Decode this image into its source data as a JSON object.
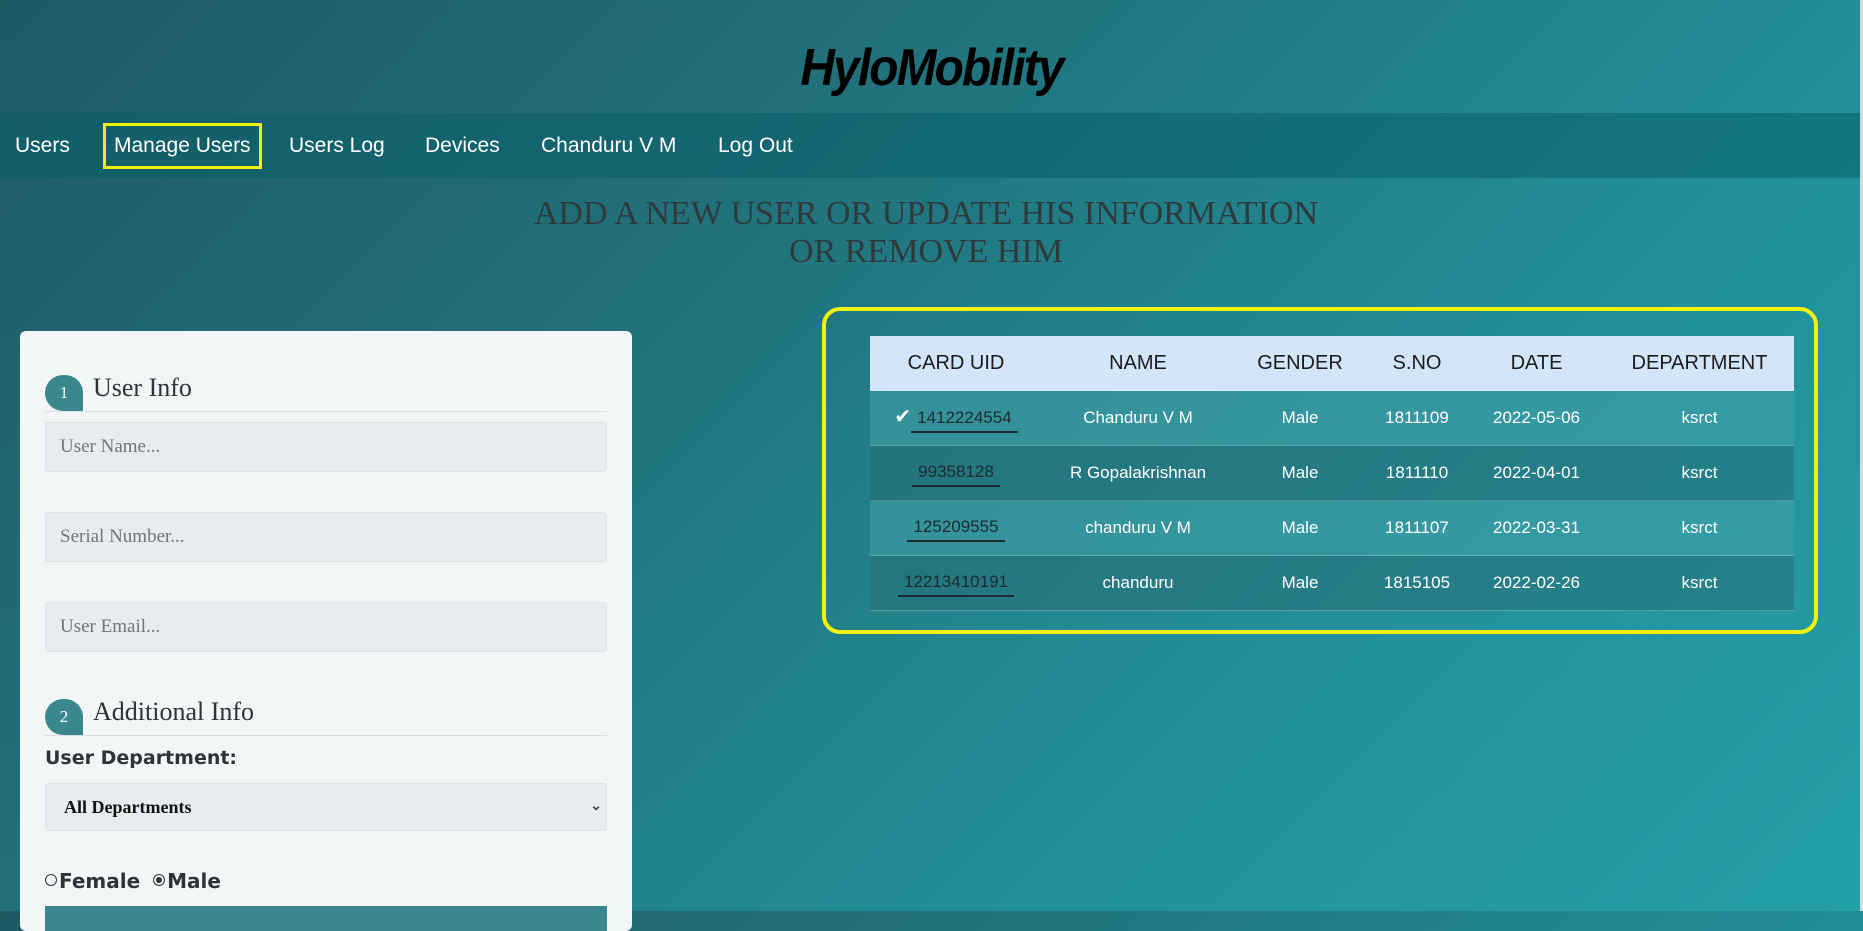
{
  "brand": "HyloMobility",
  "nav": {
    "items": [
      "Users",
      "Manage Users",
      "Users Log",
      "Devices",
      "Chanduru V M",
      "Log Out"
    ],
    "active": "Manage Users"
  },
  "heading": {
    "line1": "ADD A NEW USER OR UPDATE HIS INFORMATION",
    "line2": "OR REMOVE HIM"
  },
  "form": {
    "section1": {
      "number": "1",
      "title": "User Info"
    },
    "fields": {
      "username_placeholder": "User Name...",
      "serial_placeholder": "Serial Number...",
      "email_placeholder": "User Email..."
    },
    "section2": {
      "number": "2",
      "title": "Additional Info"
    },
    "department_label": "User Department:",
    "department_selected": "All Departments",
    "gender": {
      "female_label": "Female",
      "male_label": "Male",
      "selected": "Male"
    }
  },
  "table": {
    "headers": [
      "CARD UID",
      "NAME",
      "GENDER",
      "S.NO",
      "DATE",
      "DEPARTMENT"
    ],
    "rows": [
      {
        "selected": true,
        "uid": "1412224554",
        "name": "Chanduru V M",
        "gender": "Male",
        "sno": "1811109",
        "date": "2022-05-06",
        "department": "ksrct"
      },
      {
        "selected": false,
        "uid": "99358128",
        "name": "R Gopalakrishnan",
        "gender": "Male",
        "sno": "1811110",
        "date": "2022-04-01",
        "department": "ksrct"
      },
      {
        "selected": false,
        "uid": "125209555",
        "name": "chanduru V M",
        "gender": "Male",
        "sno": "1811107",
        "date": "2022-03-31",
        "department": "ksrct"
      },
      {
        "selected": false,
        "uid": "12213410191",
        "name": "chanduru",
        "gender": "Male",
        "sno": "1815105",
        "date": "2022-02-26",
        "department": "ksrct"
      }
    ]
  },
  "colors": {
    "accent": "#3a8790",
    "highlight": "#f2f20a",
    "header_bg": "#d2e5fa"
  }
}
